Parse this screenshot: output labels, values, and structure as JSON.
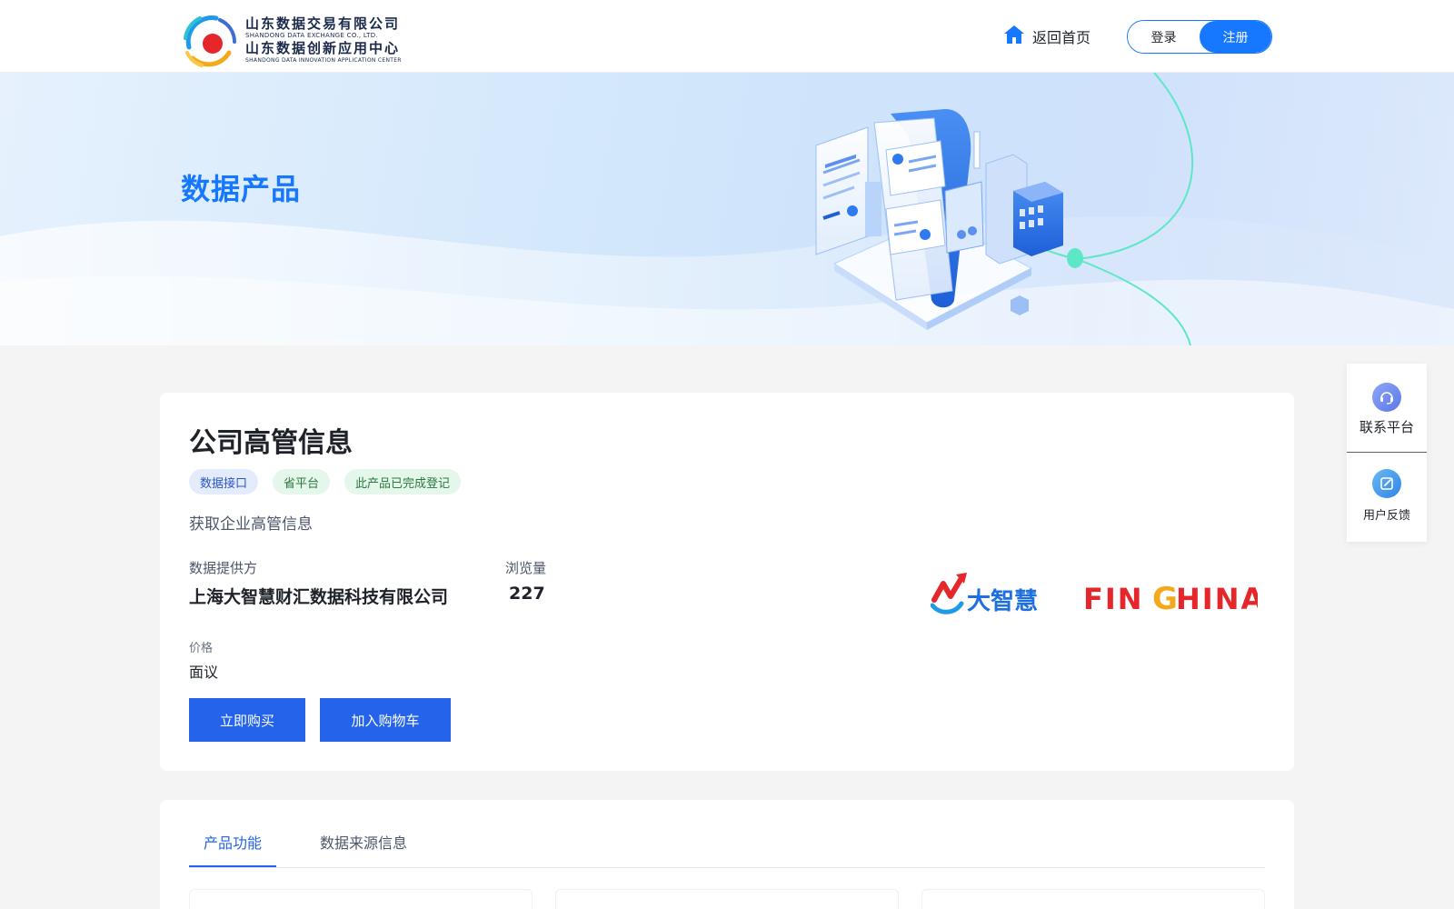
{
  "header": {
    "logo": {
      "cn_line1": "山东数据交易有限公司",
      "en_line1": "SHANDONG DATA EXCHANGE CO., LTD.",
      "cn_line2": "山东数据创新应用中心",
      "en_line2": "SHANDONG DATA INNOVATION APPLICATION CENTER"
    },
    "home_label": "返回首页",
    "home_icon": "home-icon",
    "login_label": "登录",
    "register_label": "注册"
  },
  "banner": {
    "title": "数据产品"
  },
  "product": {
    "title": "公司高管信息",
    "tags": [
      "数据接口",
      "省平台",
      "此产品已完成登记"
    ],
    "description": "获取企业高管信息",
    "provider_label": "数据提供方",
    "provider_value": "上海大智慧财汇数据科技有限公司",
    "views_label": "浏览量",
    "views_value": "227",
    "price_label": "价格",
    "price_value": "面议",
    "buy_label": "立即购买",
    "cart_label": "加入购物车",
    "provider_logo": {
      "brand_cn": "大智慧",
      "brand_en_1": "FIN",
      "brand_en_2": "G",
      "brand_en_3": "HINA"
    }
  },
  "side": {
    "contact_label": "联系平台",
    "feedback_label": "用户反馈",
    "contact_icon": "headset-icon",
    "feedback_icon": "edit-icon"
  },
  "tabs": {
    "items": [
      "产品功能",
      "数据来源信息"
    ],
    "active": 0
  },
  "colors": {
    "primary": "#1677ff",
    "button": "#2563eb",
    "tag_blue_bg": "#e4ecfb",
    "tag_green_bg": "#e4f7ea",
    "accent_teal": "#5ee7c7"
  }
}
